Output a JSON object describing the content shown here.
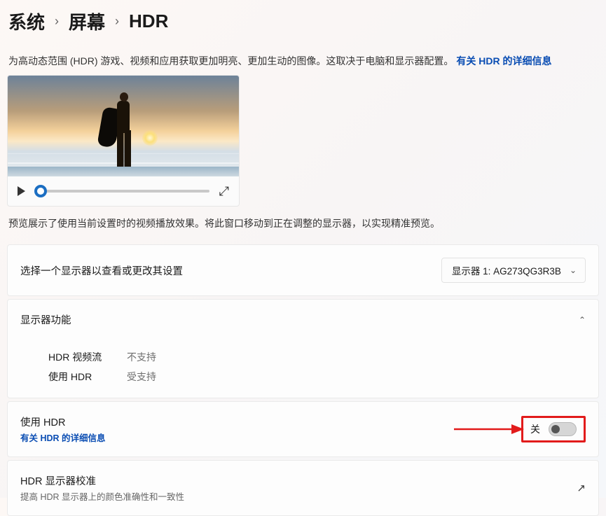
{
  "breadcrumb": {
    "l1": "系统",
    "l2": "屏幕",
    "l3": "HDR"
  },
  "desc": {
    "text": "为高动态范围 (HDR) 游戏、视频和应用获取更加明亮、更加生动的图像。这取决于电脑和显示器配置。",
    "link": "有关 HDR 的详细信息"
  },
  "preview_caption": "预览展示了使用当前设置时的视频播放效果。将此窗口移动到正在调整的显示器，以实现精准预览。",
  "display_select": {
    "label": "选择一个显示器以查看或更改其设置",
    "value": "显示器 1: AG273QG3R3B"
  },
  "capabilities": {
    "header": "显示器功能",
    "rows": [
      {
        "k": "HDR 视频流",
        "v": "不支持"
      },
      {
        "k": "使用 HDR",
        "v": "受支持"
      }
    ]
  },
  "use_hdr": {
    "title": "使用 HDR",
    "link": "有关 HDR 的详细信息",
    "state_label": "关"
  },
  "calibration": {
    "title": "HDR 显示器校准",
    "sub": "提高 HDR 显示器上的颜色准确性和一致性"
  }
}
